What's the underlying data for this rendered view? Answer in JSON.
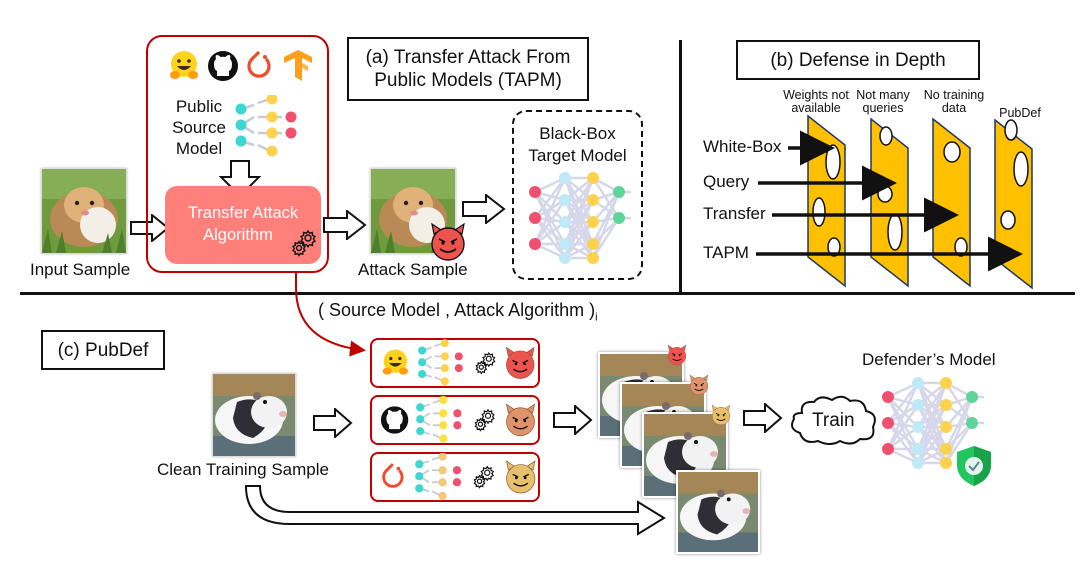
{
  "panel_a": {
    "title_line1": "(a) Transfer Attack From",
    "title_line2": "Public Models (TAPM)",
    "public_source_model_lines": [
      "Public",
      "Source",
      "Model"
    ],
    "algorithm_line1": "Transfer Attack",
    "algorithm_line2": "Algorithm",
    "input_sample_label": "Input Sample",
    "attack_sample_label": "Attack Sample",
    "target_line1": "Black-Box",
    "target_line2": "Target Model",
    "source_icons": [
      "huggingface-icon",
      "github-icon",
      "pytorch-icon",
      "tensorflow-icon"
    ]
  },
  "panel_b": {
    "title": "(b) Defense in Depth",
    "layers": [
      {
        "line1": "Weights not",
        "line2": "available"
      },
      {
        "line1": "Not many",
        "line2": "queries"
      },
      {
        "line1": "No training",
        "line2": "data"
      },
      {
        "line1": "PubDef",
        "line2": ""
      }
    ],
    "attacks": [
      {
        "label": "White-Box",
        "stops_at_layer": 1
      },
      {
        "label": "Query",
        "stops_at_layer": 2
      },
      {
        "label": "Transfer",
        "stops_at_layer": 3
      },
      {
        "label": "TAPM",
        "stops_at_layer": 4
      }
    ]
  },
  "panel_c": {
    "title": "(c) PubDef",
    "pair_label": "( Source Model , Attack Algorithm )",
    "pair_subscript": "i",
    "clean_sample_label": "Clean Training Sample",
    "train_label": "Train",
    "defender_label": "Defender’s Model",
    "rows": [
      {
        "source_icon": "huggingface-icon",
        "devil_color": "#ef5350"
      },
      {
        "source_icon": "github-icon",
        "devil_color": "#e0936a"
      },
      {
        "source_icon": "pytorch-icon",
        "devil_color": "#e8c06a"
      }
    ]
  },
  "colors": {
    "accent_red": "#c00000",
    "algorithm_fill": "#ff7f7a",
    "cheese_fill": "#ffc000",
    "cheese_stroke": "#1f3864",
    "node_cyan": "#3dd6d0",
    "node_yellow": "#ffd24d",
    "node_red": "#f0506e",
    "node_green": "#5fd49a",
    "node_lightblue": "#bfe9f7",
    "shield_green": "#22c55e"
  }
}
